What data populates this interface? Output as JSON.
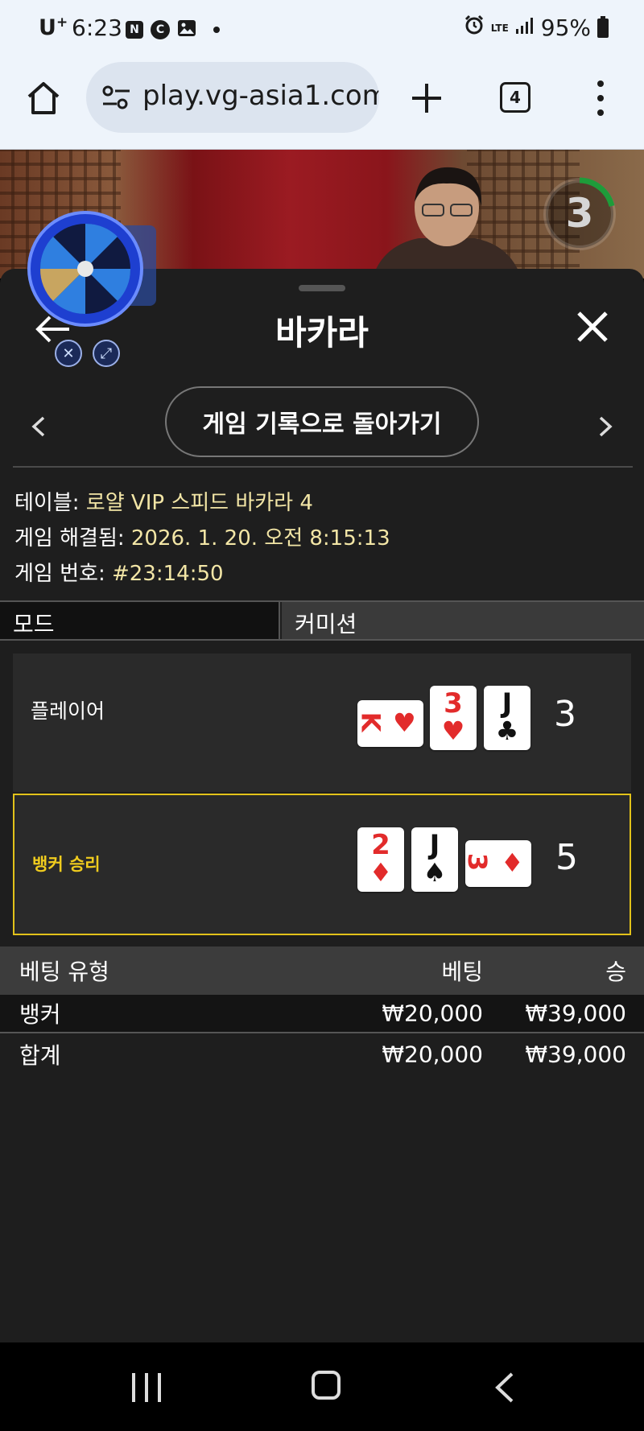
{
  "status_bar": {
    "carrier": "U",
    "carrier_plus": "+",
    "time": "6:23",
    "notif_n": "N",
    "notif_c": "C",
    "lte": "LTE",
    "battery": "95%"
  },
  "browser": {
    "url": "play.vg-asia1.com",
    "tab_count": "4"
  },
  "video": {
    "countdown": "3"
  },
  "panel": {
    "title": "바카라",
    "history_button": "게임 기록으로 돌아가기",
    "info": {
      "table_label": "테이블: ",
      "table_value": "로얄 VIP 스피드 바카라 4",
      "resolved_label": "게임 해결됨: ",
      "resolved_value": "2026. 1. 20. 오전 8:15:13",
      "number_label": "게임 번호: ",
      "number_value": "#23:14:50"
    },
    "mode": {
      "left": "모드",
      "right": "커미션"
    },
    "player": {
      "label": "플레이어",
      "score": "3",
      "cards": [
        {
          "rank": "K",
          "suit": "♥",
          "color": "red",
          "orientation": "side"
        },
        {
          "rank": "3",
          "suit": "♥",
          "color": "red",
          "orientation": "up"
        },
        {
          "rank": "J",
          "suit": "♣",
          "color": "black",
          "orientation": "up"
        }
      ]
    },
    "banker": {
      "label": "뱅커 승리",
      "score": "5",
      "cards": [
        {
          "rank": "2",
          "suit": "♦",
          "color": "red",
          "orientation": "up"
        },
        {
          "rank": "J",
          "suit": "♠",
          "color": "black",
          "orientation": "up"
        },
        {
          "rank": "3",
          "suit": "♦",
          "color": "red",
          "orientation": "side"
        }
      ]
    },
    "bets": {
      "headers": {
        "type": "베팅 유형",
        "bet": "베팅",
        "win": "승"
      },
      "rows": [
        {
          "type": "뱅커",
          "bet": "₩20,000",
          "win": "₩39,000"
        }
      ],
      "total": {
        "type": "합계",
        "bet": "₩20,000",
        "win": "₩39,000"
      }
    }
  },
  "colors": {
    "accent_gold": "#e2c21a",
    "value_text": "#f3e6a6",
    "panel_bg": "#1e1e1e"
  }
}
